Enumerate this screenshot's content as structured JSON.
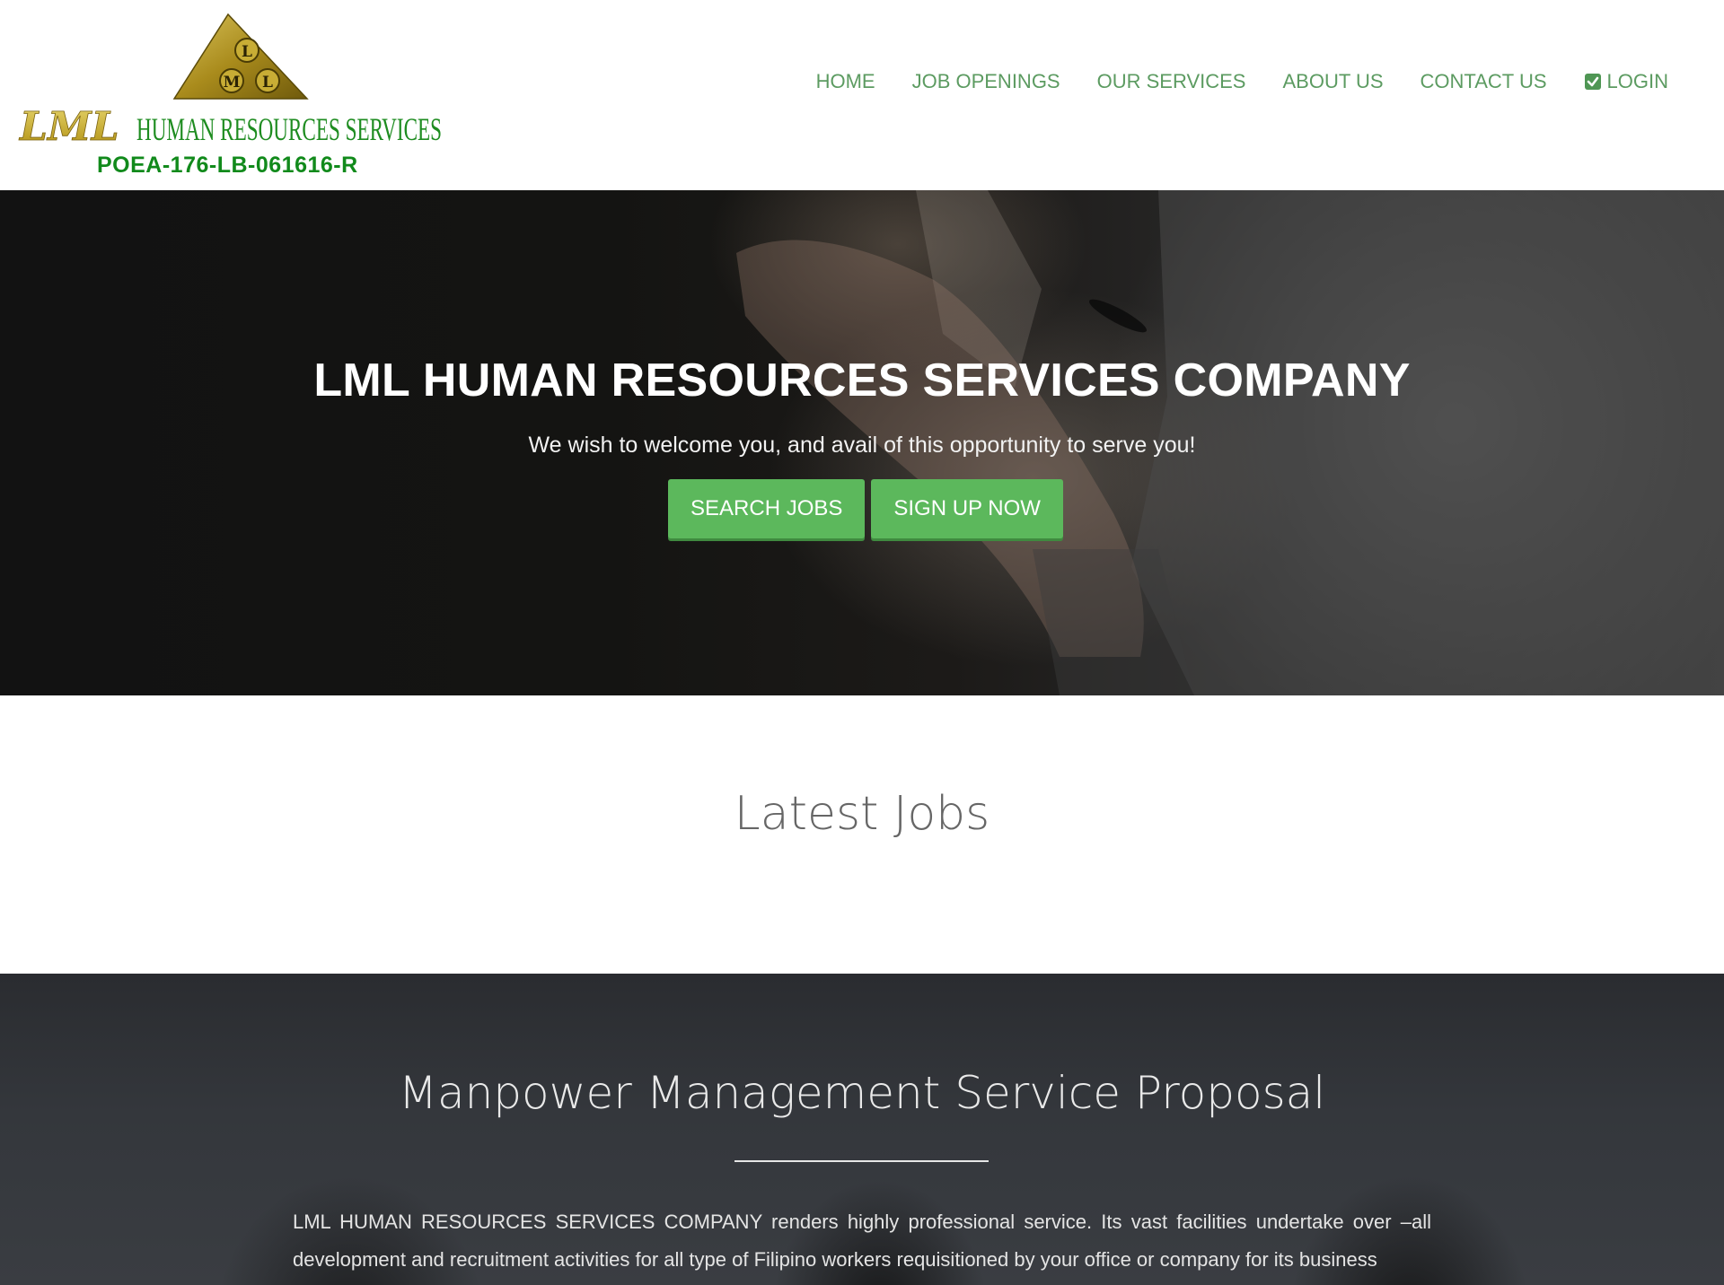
{
  "logo": {
    "initials": "LML",
    "pyramid_letters": [
      "L",
      "M",
      "L"
    ],
    "name": "HUMAN RESOURCES SERVICES",
    "license": "POEA-176-LB-061616-R"
  },
  "nav": {
    "items": [
      {
        "label": "HOME"
      },
      {
        "label": "JOB OPENINGS"
      },
      {
        "label": "OUR SERVICES"
      },
      {
        "label": "ABOUT US"
      },
      {
        "label": "CONTACT US"
      },
      {
        "label": "LOGIN",
        "icon": "check-square-icon"
      }
    ],
    "color": "#5c9b61"
  },
  "hero": {
    "title": "LML HUMAN RESOURCES SERVICES COMPANY",
    "subtitle": "We wish to welcome you, and avail of this opportunity to serve you!",
    "search_button": "SEARCH JOBS",
    "signup_button": "SIGN UP NOW",
    "button_color": "#5cb85c"
  },
  "latest_jobs": {
    "title": "Latest Jobs"
  },
  "proposal": {
    "title": "Manpower Management Service Proposal",
    "text": "LML HUMAN RESOURCES SERVICES COMPANY renders highly professional service. Its vast facilities undertake over –all development and recruitment activities for all type of Filipino workers requisitioned by your office or company for its business"
  }
}
